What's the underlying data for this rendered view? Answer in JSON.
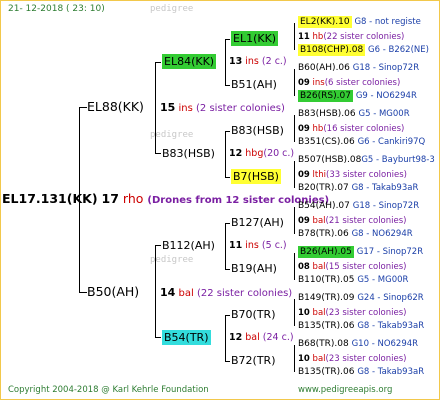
{
  "header": {
    "date": "21- 12-2018 ( 23: 10)"
  },
  "footer": {
    "copyright": "Copyright 2004-2018 @ Karl Kehrle Foundation",
    "site": "www.pedigreeapis.org"
  },
  "watermark": [
    "pedigree",
    "pedigree",
    "pedigree"
  ],
  "root": {
    "id": "EL17.131(KK)",
    "num": "17",
    "tag": "rho",
    "note": "(Drones from 12 sister colonies)"
  },
  "gen1": [
    {
      "id": "EL88(KK)",
      "num": "15",
      "tag": "ins",
      "cnt": "(2 sister colonies)"
    },
    {
      "id": "B50(AH)",
      "num": "14",
      "tag": "bal",
      "cnt": "(22 sister colonies)"
    }
  ],
  "gen2": [
    {
      "id": "EL84(KK)",
      "num": "13",
      "tag": "ins",
      "cnt": "(2 c.)"
    },
    {
      "id": "B83(HSB)",
      "num": "12",
      "tag": "hbg",
      "cnt": "(20 c.)"
    },
    {
      "id": "B112(AH)",
      "num": "11",
      "tag": "ins",
      "cnt": "(5 c.)"
    },
    {
      "id": "B54(TR)",
      "num": "12",
      "tag": "bal",
      "cnt": "(24 c.)"
    }
  ],
  "gen3": [
    {
      "id": "EL1(KK)"
    },
    {
      "id": "B51(AH)"
    },
    {
      "id": "B83(HSB)"
    },
    {
      "id": "B7(HSB)"
    },
    {
      "id": "B127(AH)"
    },
    {
      "id": "B19(AH)"
    },
    {
      "id": "B70(TR)"
    },
    {
      "id": "B72(TR)"
    }
  ],
  "gen4": [
    {
      "top": "EL2(KK).10",
      "toploc": "G8 - not registe",
      "num": "11",
      "tag": "hb",
      "cnt": "(22 sister colonies)",
      "bot": "B108(CHP).08",
      "botloc": "G6 - B262(NE)"
    },
    {
      "top": "B60(AH).06",
      "toploc": "G18 - Sinop72R",
      "num": "09",
      "tag": "ins",
      "cnt": "(6 sister colonies)",
      "bot": "B26(RS).07",
      "botloc": "G9 - NO6294R"
    },
    {
      "top": "B83(HSB).06",
      "toploc": "G5 - MG00R",
      "num": "09",
      "tag": "hb",
      "cnt": "(16 sister colonies)",
      "bot": "B351(CS).06",
      "botloc": "G6 - Cankiri97Q"
    },
    {
      "top": "B507(HSB).08",
      "toploc": "G5 - Bayburt98-3",
      "num": "09",
      "tag": "lthi",
      "cnt": "(33 sister colonies)",
      "bot": "B20(TR).07",
      "botloc": "G8 - Takab93aR"
    },
    {
      "top": "B54(AH).07",
      "toploc": "G18 - Sinop72R",
      "num": "09",
      "tag": "bal",
      "cnt": "(21 sister colonies)",
      "bot": "B78(TR).06",
      "botloc": "G8 - NO6294R"
    },
    {
      "top": "B26(AH).05",
      "toploc": "G17 - Sinop72R",
      "num": "08",
      "tag": "bal",
      "cnt": "(15 sister colonies)",
      "bot": "B110(TR).05",
      "botloc": "G5 - MG00R"
    },
    {
      "top": "B149(TR).09",
      "toploc": "G24 - Sinop62R",
      "num": "10",
      "tag": "bal",
      "cnt": "(23 sister colonies)",
      "bot": "B135(TR).06",
      "botloc": "G8 - Takab93aR"
    },
    {
      "top": "B68(TR).08",
      "toploc": "G10 - NO6294R",
      "num": "10",
      "tag": "bal",
      "cnt": "(23 sister colonies)",
      "bot": "B135(TR).06",
      "botloc": "G8 - Takab93aR"
    }
  ],
  "colors": {
    "border": "#f2c84b",
    "green": "#33cc33",
    "yellow": "#ffff33",
    "cyan": "#33dddd",
    "red": "#cc0000",
    "purple": "#7a1fa2",
    "blue": "#1b3fa8",
    "footer": "#2e7d32"
  }
}
